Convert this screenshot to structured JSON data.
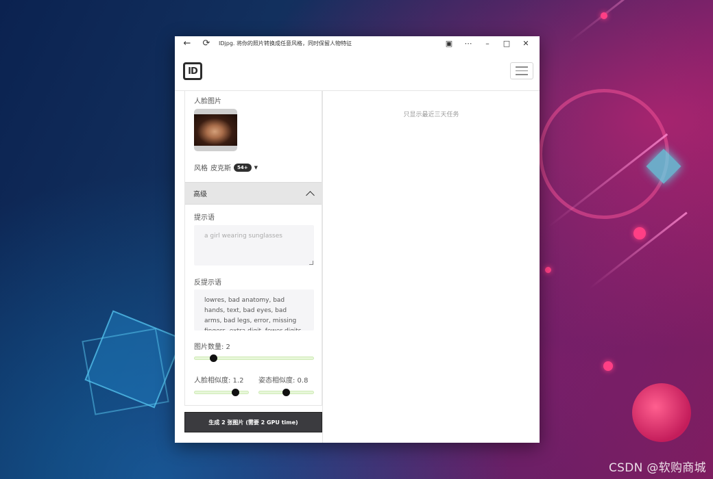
{
  "window": {
    "title": "IDjpg. 将你的照片转换成任意风格，同时保留人物特征"
  },
  "navbar": {
    "logo_text": "ID"
  },
  "left_panel": {
    "face_image_label": "人脸图片",
    "style_label": "风格",
    "style_value": "皮克斯",
    "style_count_badge": "54+",
    "advanced": {
      "header": "高级",
      "expanded": true,
      "prompt_label": "提示语",
      "prompt_placeholder": "a girl wearing sunglasses",
      "negative_prompt_label": "反提示语",
      "negative_prompt_value": "lowres, bad anatomy, bad hands, text, bad eyes, bad arms, bad legs, error, missing fingers, extra digit, fewer digits",
      "image_count_label": "图片数量: 2",
      "image_count_value": 2,
      "face_similarity_label": "人脸相似度: 1.2",
      "face_similarity_value": 1.2,
      "pose_similarity_label": "姿态相似度: 0.8",
      "pose_similarity_value": 0.8
    },
    "generate_button": "生成 2 张图片 (需要 2 GPU time)"
  },
  "right_panel": {
    "notice": "只显示最近三天任务"
  },
  "desktop": {
    "watermark": "CSDN @软购商城"
  },
  "colors": {
    "accent_dark": "#3b3b3f",
    "slider_track": "#e7f7d9",
    "badge": "#2f2f2f"
  }
}
